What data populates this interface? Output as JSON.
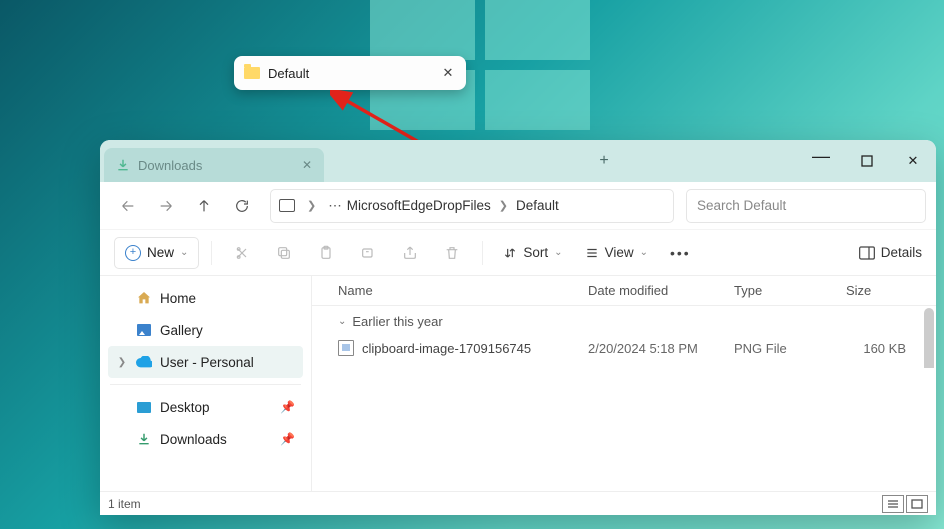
{
  "drag_tab": {
    "label": "Default"
  },
  "window": {
    "tab_label": "Downloads",
    "breadcrumb": {
      "seg1": "MicrosoftEdgeDropFiles",
      "seg2": "Default"
    },
    "search_placeholder": "Search Default",
    "toolbar": {
      "new_label": "New",
      "sort_label": "Sort",
      "view_label": "View",
      "details_label": "Details"
    },
    "nav": {
      "home": "Home",
      "gallery": "Gallery",
      "user": "User - Personal",
      "desktop": "Desktop",
      "downloads": "Downloads"
    },
    "columns": {
      "name": "Name",
      "date": "Date modified",
      "type": "Type",
      "size": "Size"
    },
    "group_label": "Earlier this year",
    "files": [
      {
        "name": "clipboard-image-1709156745",
        "date": "2/20/2024 5:18 PM",
        "type": "PNG File",
        "size": "160 KB"
      }
    ],
    "status": "1 item"
  }
}
